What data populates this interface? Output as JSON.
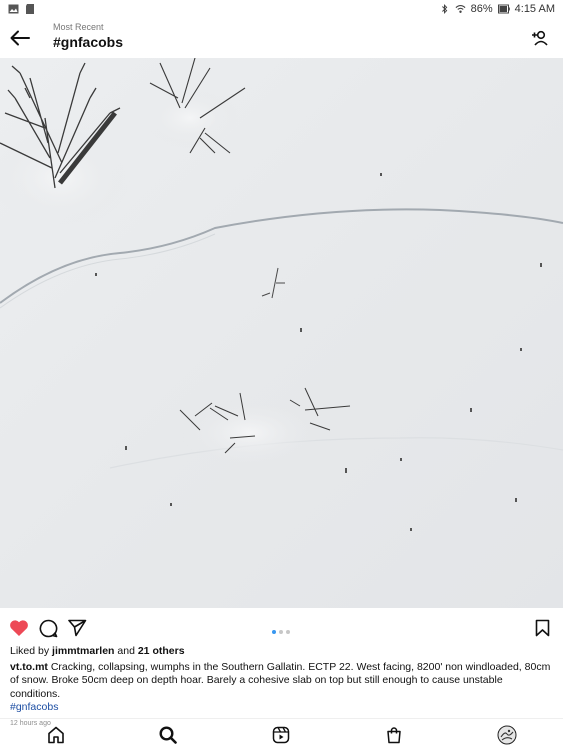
{
  "status_bar": {
    "battery": "86%",
    "time": "4:15 AM",
    "left_icons": [
      "gallery-icon",
      "sd-card-icon"
    ],
    "right_icons": [
      "bluetooth-icon",
      "wifi-icon",
      "battery-icon"
    ]
  },
  "header": {
    "subtitle": "Most Recent",
    "title": "#gnfacobs",
    "back_icon": "arrow-left-icon",
    "follow_icon": "add-person-icon"
  },
  "post": {
    "image_description_colors": {
      "snow": "#e9eaec",
      "shrub": "#3a3a3a",
      "crack": "#9aa3ab"
    },
    "carousel": {
      "count": 3,
      "active_index": 0
    },
    "actions": [
      "heart-icon",
      "comment-icon",
      "share-icon",
      "bookmark-icon"
    ],
    "liked": true,
    "likes_prefix": "Liked by",
    "likes_user": "jimmtmarlen",
    "likes_and": "and",
    "likes_others": "21 others",
    "author": "vt.to.mt",
    "caption": " Cracking, collapsing, wumphs in the Southern Gallatin. ECTP 22. West facing, 8200' non windloaded, 80cm of snow. Broke 50cm deep on depth hoar. Barely a cohesive slab on top but still enough to cause unstable conditions.",
    "hashtag": "#gnfacobs",
    "time_ago": "12 hours ago"
  },
  "tabbar": {
    "items": [
      "home-icon",
      "search-icon",
      "reels-icon",
      "shop-icon",
      "profile-avatar"
    ],
    "active": "search-icon"
  },
  "colors": {
    "heart": "#ed4956",
    "link": "#1d4ea3",
    "dot_active": "#3897f0"
  }
}
